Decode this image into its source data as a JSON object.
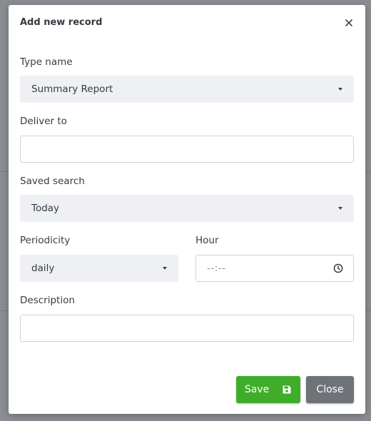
{
  "dialog": {
    "title": "Add new record",
    "close_icon": "close-icon"
  },
  "form": {
    "type_name": {
      "label": "Type name",
      "value": "Summary Report"
    },
    "deliver_to": {
      "label": "Deliver to",
      "value": ""
    },
    "saved_search": {
      "label": "Saved search",
      "value": "Today"
    },
    "periodicity": {
      "label": "Periodicity",
      "value": "daily"
    },
    "hour": {
      "label": "Hour",
      "value": "--:--"
    },
    "description": {
      "label": "Description",
      "value": ""
    }
  },
  "buttons": {
    "save_label": "Save",
    "save_icon": "floppy-disk-icon",
    "close_label": "Close"
  },
  "colors": {
    "save_button": "#3fad2a",
    "close_button": "#6e7378",
    "select_bg": "#eef0f4"
  }
}
